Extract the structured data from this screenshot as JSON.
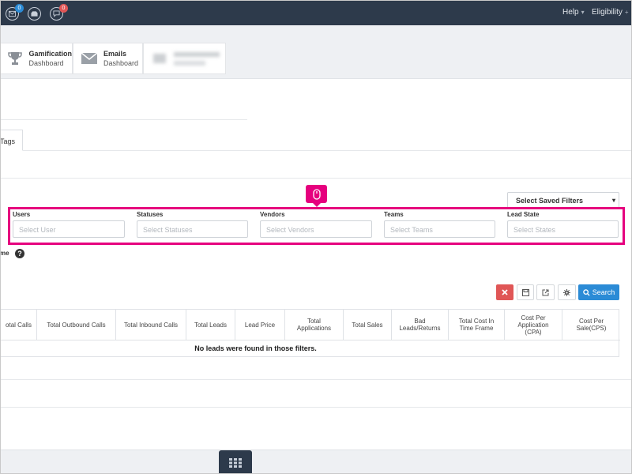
{
  "topbar": {
    "mail_badge": "0",
    "chat_badge": "0",
    "help_label": "Help",
    "eligibility_label": "Eligibility",
    "mail_badge_color": "#2b8bd6",
    "chat_badge_color": "#e05656",
    "bg_color": "#2d3a4b"
  },
  "dashboards": [
    {
      "title": "Gamification",
      "subtitle": "Dashboard",
      "icon": "trophy-icon"
    },
    {
      "title": "Emails",
      "subtitle": "Dashboard",
      "icon": "envelope-icon"
    }
  ],
  "tabs": {
    "tags_label": "Tags"
  },
  "saved_filters": {
    "label": "Select Saved Filters"
  },
  "filters": [
    {
      "label": "Users",
      "placeholder": "Select User"
    },
    {
      "label": "Statuses",
      "placeholder": "Select Statuses"
    },
    {
      "label": "Vendors",
      "placeholder": "Select Vendors"
    },
    {
      "label": "Teams",
      "placeholder": "Select Teams"
    },
    {
      "label": "Lead State",
      "placeholder": "Select States"
    }
  ],
  "time_frame": {
    "label": "me",
    "help": "?"
  },
  "toolbar": {
    "clear_icon": "close-icon",
    "save_icon": "save-icon",
    "export_icon": "external-link-icon",
    "settings_icon": "gear-icon",
    "search_label": "Search",
    "accent_color": "#2b8bd6",
    "danger_color": "#e05656"
  },
  "table": {
    "columns": [
      "otal Calls",
      "Total Outbound Calls",
      "Total Inbound Calls",
      "Total Leads",
      "Lead Price",
      "Total Applications",
      "Total Sales",
      "Bad Leads/Returns",
      "Total Cost In Time Frame",
      "Cost Per Application (CPA)",
      "Cost Per Sale(CPS)"
    ],
    "empty_message": "No leads were found in those filters."
  },
  "highlight_color": "#e6007e"
}
